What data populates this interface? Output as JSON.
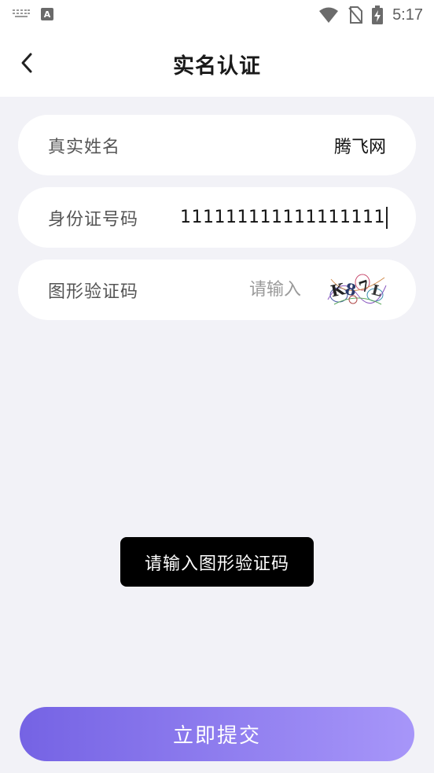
{
  "status_bar": {
    "time": "5:17",
    "icons": [
      "keyboard-icon",
      "a-app-icon",
      "wifi-icon",
      "no-sim-icon",
      "battery-charging-icon"
    ]
  },
  "header": {
    "title": "实名认证",
    "back_icon": "chevron-left-icon"
  },
  "form": {
    "real_name": {
      "label": "真实姓名",
      "value": "腾飞网"
    },
    "id_number": {
      "label": "身份证号码",
      "value": "111111111111111111"
    },
    "captcha": {
      "label": "图形验证码",
      "placeholder": "请输入",
      "image_text": "K87L"
    }
  },
  "toast": {
    "message": "请输入图形验证码"
  },
  "submit": {
    "label": "立即提交"
  },
  "colors": {
    "background": "#f2f2f7",
    "card": "#ffffff",
    "button_gradient_start": "#7563e4",
    "button_gradient_end": "#a796f9",
    "toast": "#000000"
  }
}
